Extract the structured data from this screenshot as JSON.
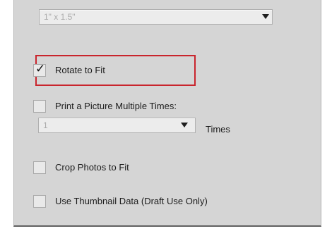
{
  "paper_size": {
    "selected": "1\" x 1.5\""
  },
  "rotate_to_fit": {
    "label": "Rotate to Fit",
    "checked": true,
    "highlight_color": "#c9252d"
  },
  "print_multiple": {
    "label": "Print a Picture Multiple Times:",
    "checked": false,
    "times_value": "1",
    "times_label": "Times"
  },
  "crop_photos": {
    "label": "Crop Photos to Fit",
    "checked": false
  },
  "thumbnail_data": {
    "label": "Use Thumbnail Data (Draft Use Only)",
    "checked": false
  },
  "icons": {
    "dropdown": "chevron-down-icon",
    "check": "checkmark-icon"
  }
}
